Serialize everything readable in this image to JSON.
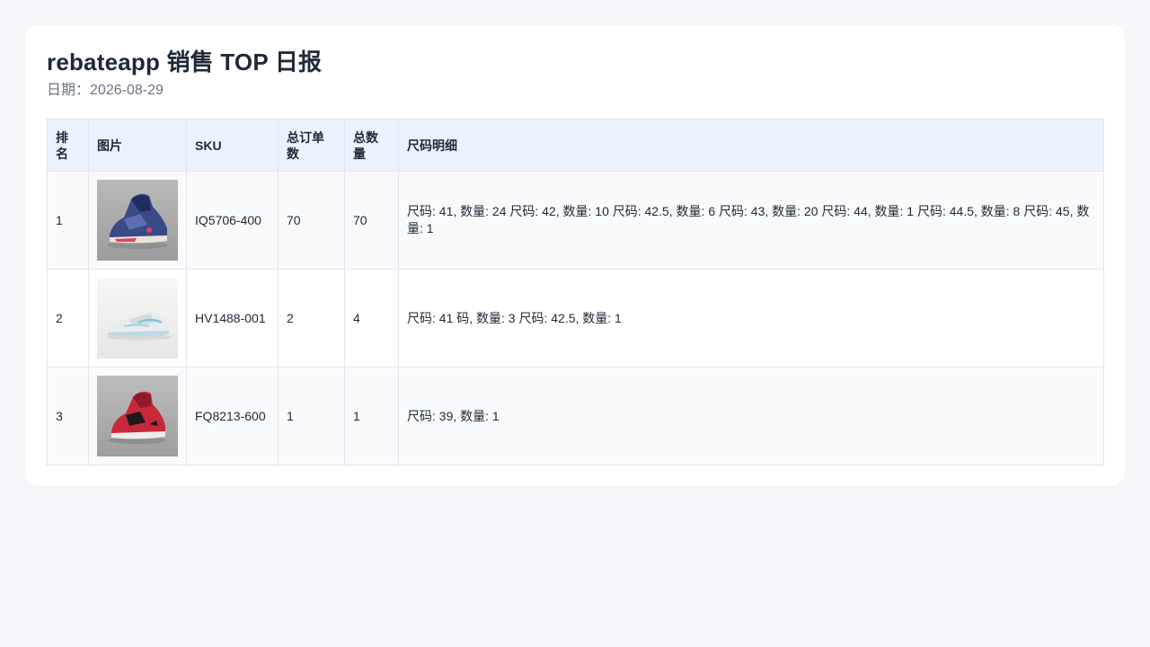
{
  "report": {
    "title": "rebateapp 销售 TOP 日报",
    "date_label": "日期：",
    "date": "2026-08-29"
  },
  "table": {
    "headers": {
      "rank": "排名",
      "image": "图片",
      "sku": "SKU",
      "orders": "总订单数",
      "qty": "总数量",
      "sizes": "尺码明细"
    },
    "rows": [
      {
        "rank": "1",
        "image_icon": "sneaker-navy-red-icon",
        "sku": "IQ5706-400",
        "orders": "70",
        "qty": "70",
        "sizes": "尺码: 41, 数量: 24 尺码: 42, 数量: 10 尺码: 42.5, 数量: 6 尺码: 43, 数量: 20 尺码: 44, 数量: 1 尺码: 44.5, 数量: 8 尺码: 45, 数量: 1"
      },
      {
        "rank": "2",
        "image_icon": "sneaker-white-icon",
        "sku": "HV1488-001",
        "orders": "2",
        "qty": "4",
        "sizes": "尺码: 41 码, 数量: 3 尺码: 42.5, 数量: 1"
      },
      {
        "rank": "3",
        "image_icon": "sneaker-red-icon",
        "sku": "FQ8213-600",
        "orders": "1",
        "qty": "1",
        "sizes": "尺码: 39, 数量: 1"
      }
    ]
  },
  "colors": {
    "page_bg": "#f5f7fa",
    "header_bg": "#eaf2fe",
    "border": "#e2e6ec"
  }
}
